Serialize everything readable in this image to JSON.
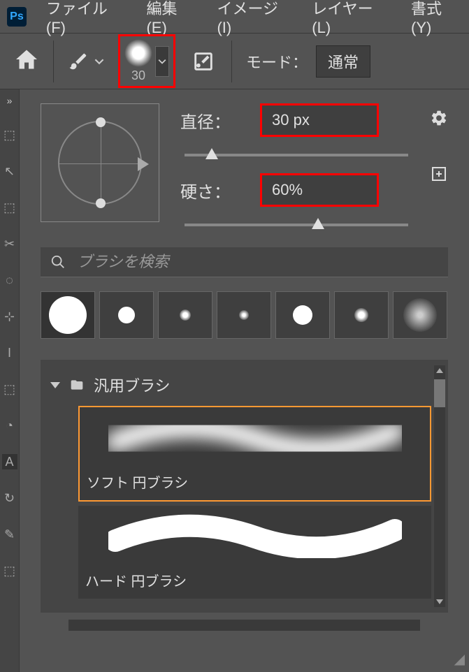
{
  "menubar": {
    "items": [
      "ファイル(F)",
      "編集(E)",
      "イメージ(I)",
      "レイヤー(L)",
      "書式(Y)"
    ]
  },
  "options": {
    "brush_size": "30",
    "mode_label": "モード：",
    "mode_value": "通常"
  },
  "panel": {
    "diameter_label": "直径：",
    "diameter_value": "30 px",
    "hardness_label": "硬さ：",
    "hardness_value": "60%",
    "search_placeholder": "ブラシを検索",
    "folder_name": "汎用ブラシ",
    "brushes": [
      {
        "label": "ソフト 円ブラシ",
        "selected": true,
        "soft": true
      },
      {
        "label": "ハード 円ブラシ",
        "selected": false,
        "soft": false
      }
    ]
  }
}
